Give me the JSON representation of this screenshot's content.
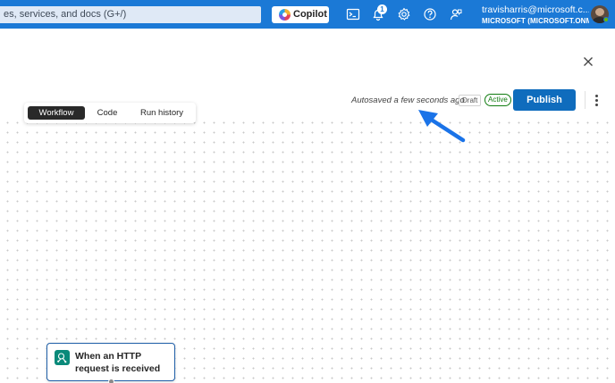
{
  "topbar": {
    "search_placeholder": "es, services, and docs (G+/)",
    "copilot_label": "Copilot",
    "notification_count": "1",
    "account_email": "travisharris@microsoft.c...",
    "account_tenant": "MICROSOFT (MICROSOFT.ONMI..."
  },
  "header": {
    "autosave_status": "Autosaved a few seconds ago",
    "draft_badge": "Draft",
    "active_badge": "Active",
    "publish_label": "Publish"
  },
  "tabs": [
    {
      "label": "Workflow",
      "selected": true
    },
    {
      "label": "Code",
      "selected": false
    },
    {
      "label": "Run history",
      "selected": false
    }
  ],
  "trigger": {
    "label": "When an HTTP request is received"
  },
  "colors": {
    "topbar_bg": "#1b79d6",
    "publish_bg": "#0f6cbd",
    "active_green": "#107c10",
    "arrow_blue": "#1a73e8",
    "trigger_icon_bg": "#0a8a7a"
  }
}
